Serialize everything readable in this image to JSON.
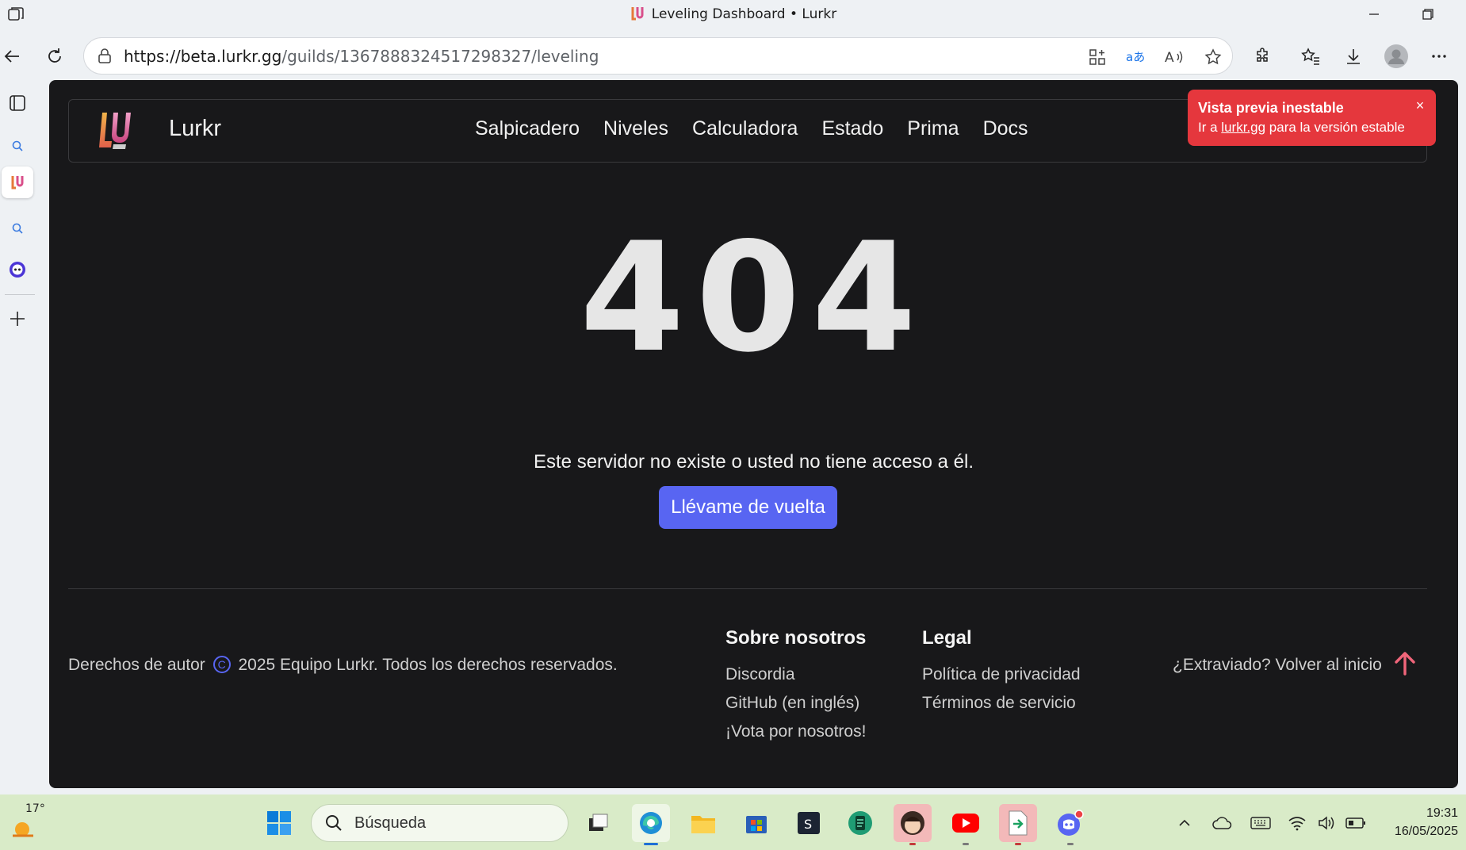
{
  "window": {
    "title": "Leveling Dashboard • Lurkr"
  },
  "browser": {
    "url_host": "https://beta.lurkr.gg",
    "url_path": "/guilds/1367888324517298327/leveling"
  },
  "site": {
    "name": "Lurkr",
    "nav": [
      "Salpicadero",
      "Niveles",
      "Calculadora",
      "Estado",
      "Prima",
      "Docs"
    ]
  },
  "toast": {
    "title": "Vista previa inestable",
    "body_prefix": "Ir a",
    "link": "lurkr.gg",
    "body_suffix": "para la versión estable",
    "close": "×"
  },
  "error": {
    "code": "404",
    "message": "Este servidor no existe o usted no tiene acceso a él.",
    "button": "Llévame de vuelta"
  },
  "footer": {
    "copyright_prefix": "Derechos de autor",
    "copyright_symbol": "C",
    "copyright_suffix": "2025 Equipo Lurkr. Todos los derechos reservados.",
    "about": {
      "heading": "Sobre nosotros",
      "links": [
        "Discordia",
        "GitHub (en inglés)",
        "¡Vota por nosotros!"
      ]
    },
    "legal": {
      "heading": "Legal",
      "links": [
        "Política de privacidad",
        "Términos de servicio"
      ]
    },
    "back_to_top": "¿Extraviado? Volver al inicio"
  },
  "taskbar": {
    "weather_temp": "17°",
    "search_placeholder": "Búsqueda",
    "time": "19:31",
    "date": "16/05/2025"
  },
  "colors": {
    "accent": "#5865f2",
    "toast": "#e5373d",
    "page_bg": "#18181a",
    "taskbar": "#d9ebc8"
  }
}
